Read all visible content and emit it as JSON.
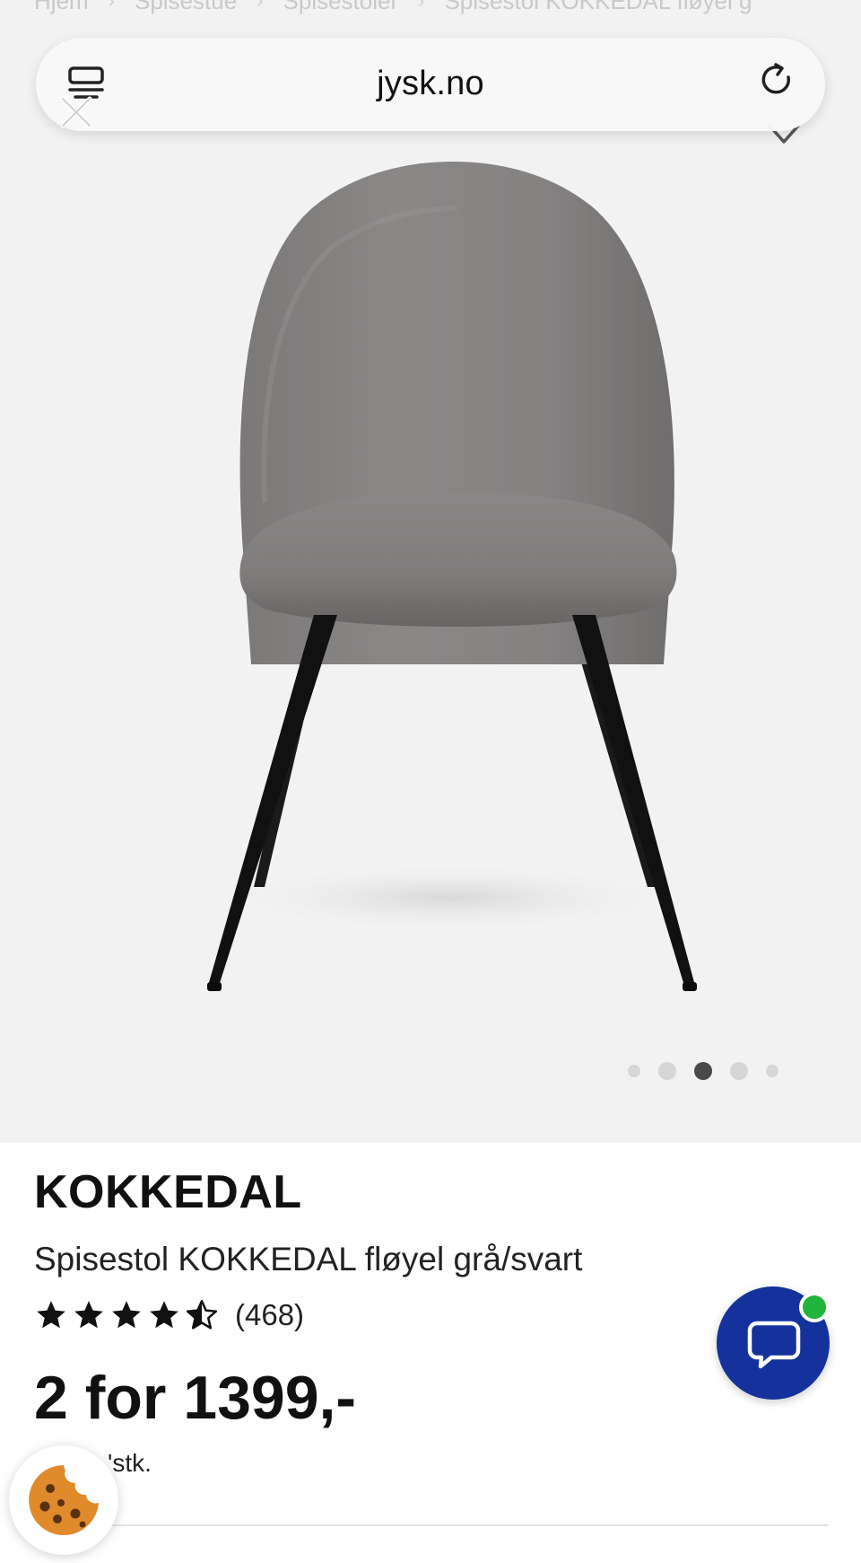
{
  "breadcrumb": {
    "items": [
      "Hjem",
      "Spisestue",
      "Spisestoler",
      "Spisestol KOKKEDAL fløyel g"
    ]
  },
  "browser": {
    "url": "jysk.no",
    "icons": [
      "tabs-icon",
      "close-icon",
      "reload-icon"
    ]
  },
  "gallery": {
    "image_count": 5,
    "active_index": 3,
    "icons": [
      "heart-icon"
    ]
  },
  "product": {
    "name": "KOKKEDAL",
    "description": "Spisestol KOKKEDAL fløyel grå/svart",
    "rating": 4.5,
    "rating_max": 5,
    "review_count": "(468)",
    "price": "2 for 1399,-",
    "unit_price": "'stk."
  },
  "chat": {
    "icon": "chat-bubble-icon",
    "status_color": "#22b33a",
    "button_color": "#15329c"
  },
  "cookie": {
    "icon": "cookie-icon"
  }
}
